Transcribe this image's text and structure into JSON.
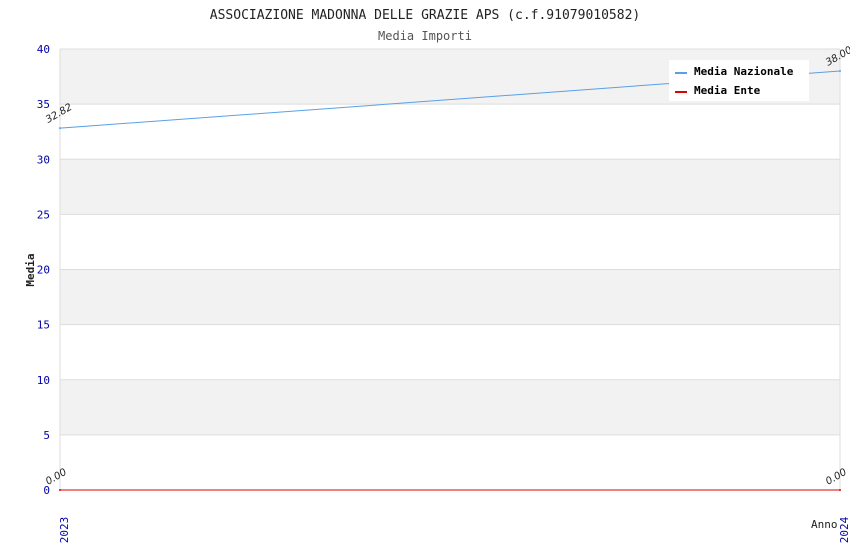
{
  "chart_data": {
    "type": "line",
    "title": "ASSOCIAZIONE MADONNA DELLE GRAZIE APS (c.f.91079010582)",
    "subtitle": "Media Importi",
    "xlabel": "Anno",
    "ylabel": "Media",
    "categories": [
      "2023",
      "2024"
    ],
    "ylim": [
      0,
      40
    ],
    "yticks": [
      "0",
      "5",
      "10",
      "15",
      "20",
      "25",
      "30",
      "35",
      "40"
    ],
    "grid": true,
    "legend_position": "top-right",
    "series": [
      {
        "name": "Media Nazionale",
        "values": [
          32.82,
          38.0
        ],
        "labels": [
          "32.82",
          "38.00"
        ],
        "color": "#5aa0e6"
      },
      {
        "name": "Media Ente",
        "values": [
          0.0,
          0.0
        ],
        "labels": [
          "0.00",
          "0.00"
        ],
        "color": "#e00000"
      }
    ],
    "colors": {
      "band": "#f2f2f2",
      "gridline": "#dddddd",
      "tick_text": "#0000aa",
      "text": "#333333"
    }
  }
}
